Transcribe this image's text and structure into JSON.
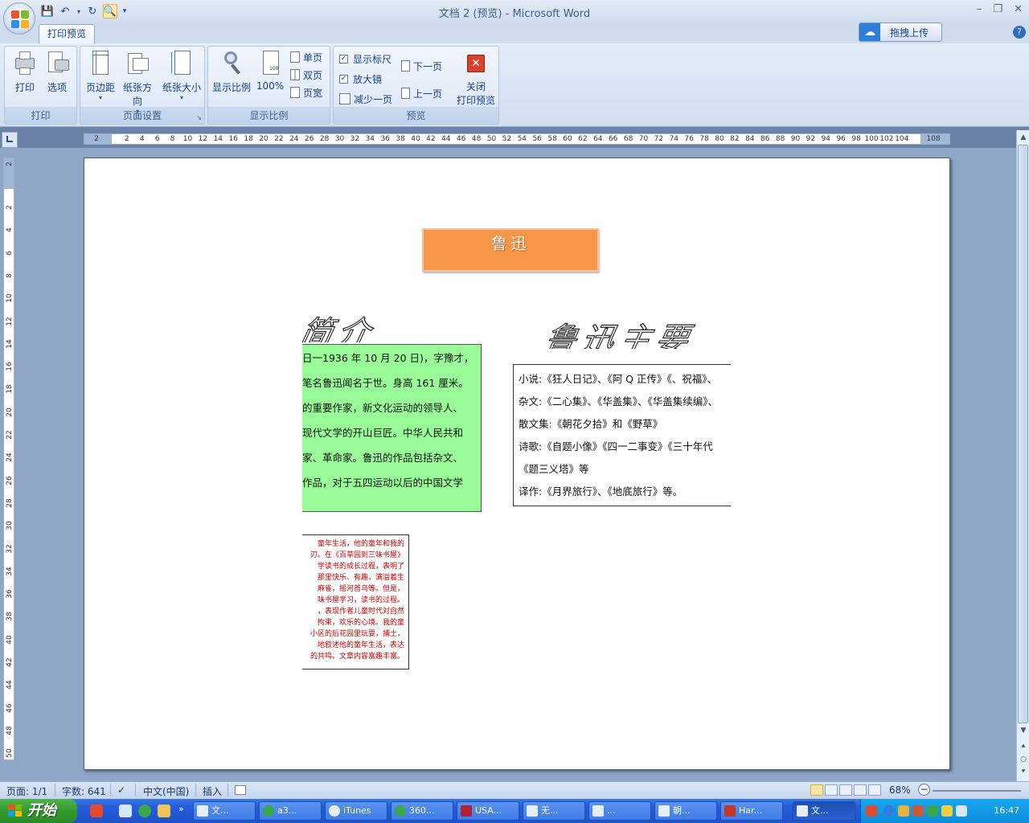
{
  "window": {
    "title": "文档 2 (预览) - Microsoft Word"
  },
  "ribbon": {
    "active_tab": "打印预览",
    "upload_label": "拖拽上传",
    "groups": {
      "print": {
        "label": "打印",
        "print": "打印",
        "options": "选项"
      },
      "page_setup": {
        "label": "页面设置",
        "margins": "页边距",
        "orientation": "纸张方向",
        "size": "纸张大小"
      },
      "zoom": {
        "label": "显示比例",
        "zoom": "显示比例",
        "percent": "100%",
        "one_page": "单页",
        "two_pages": "双页",
        "page_width": "页宽"
      },
      "preview": {
        "label": "预览",
        "show_ruler": "显示标尺",
        "magnifier": "放大镜",
        "shrink_one_page": "减少一页",
        "next_page": "下一页",
        "prev_page": "上一页",
        "close": "关闭",
        "close2": "打印预览"
      }
    }
  },
  "ruler": {
    "horizontal": [
      "2",
      "2",
      "4",
      "6",
      "8",
      "10",
      "12",
      "14",
      "16",
      "18",
      "20",
      "22",
      "24",
      "26",
      "28",
      "30",
      "32",
      "34",
      "36",
      "38",
      "40",
      "42",
      "44",
      "46",
      "48",
      "50",
      "52",
      "54",
      "56",
      "58",
      "60",
      "62",
      "64",
      "66",
      "68",
      "70",
      "72",
      "74",
      "76",
      "78",
      "80",
      "82",
      "84",
      "86",
      "88",
      "90",
      "92",
      "94",
      "96",
      "98",
      "100",
      "102",
      "104",
      "108"
    ],
    "vertical": [
      "2",
      "2",
      "4",
      "6",
      "8",
      "10",
      "12",
      "14",
      "16",
      "18",
      "20",
      "22",
      "24",
      "26",
      "28",
      "30",
      "32",
      "34",
      "36",
      "38",
      "40",
      "42",
      "44",
      "46",
      "48",
      "50"
    ]
  },
  "document": {
    "main_title": "鲁迅",
    "intro_title": "简介",
    "works_title": "鲁迅主要",
    "intro_lines": [
      "日一1936 年 10 月 20 日)，字豫才，",
      "笔名鲁迅闻名于世。身高 161 厘米。",
      "的重要作家，新文化运动的领导人、",
      "现代文学的开山巨匠。中华人民共和",
      "家、革命家。鲁迅的作品包括杂文、",
      "作品，对于五四运动以后的中国文学"
    ],
    "works_lines": [
      "小说:《狂人日记》、《阿 Q 正传》《、祝福》、",
      "杂文:《二心集》、《华盖集》、《华盖集续编》、",
      "散文集:《朝花夕拾》和《野草》",
      "诗歌:《自题小像》《四一二事变》《三十年代",
      "《题三义塔》等",
      "译作:《月界旅行》、《地底旅行》等。"
    ],
    "child_lines": [
      "童年生活，他的童年和我的",
      "刃。在《百草园到三味书屋》",
      "学读书的成长过程，表明了",
      "那里快乐、有趣，满溢着生",
      "麻雀，摇河首乌等。但是，",
      "味书屋学习，读书的过程。",
      "，表现作者儿童时代对自然",
      "拘束，欢乐的心境。我的童",
      "小区的后花园里玩耍，捕土，",
      "地叙述他的童年生活，表达",
      "的共鸣。文章内容富趣丰富。"
    ]
  },
  "statusbar": {
    "page": "页面: 1/1",
    "words": "字数: 641",
    "language": "中文(中国)",
    "mode": "插入",
    "zoom": "68%"
  },
  "taskbar": {
    "start": "开始",
    "tasks": [
      "文...",
      "a3...",
      "iTunes",
      "360...",
      "USA...",
      "无...",
      "...",
      "朝...",
      "Har...",
      "文..."
    ],
    "clock": "16:47"
  },
  "colors": {
    "title_box": "#f79646",
    "intro_box": "#98fb98",
    "child_text": "#cc0000"
  }
}
